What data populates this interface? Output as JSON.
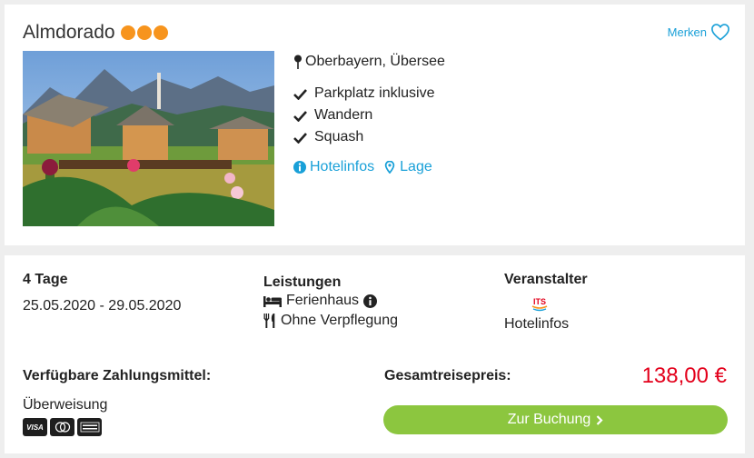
{
  "hotel": {
    "name": "Almdorado",
    "rating_dots": 3,
    "location": "Oberbayern, Übersee",
    "features": [
      "Parkplatz inklusive",
      "Wandern",
      "Squash"
    ],
    "links": {
      "info": "Hotelinfos",
      "map": "Lage"
    },
    "save_label": "Merken"
  },
  "trip": {
    "duration": "4 Tage",
    "dates": "25.05.2020 - 29.05.2020"
  },
  "services": {
    "title": "Leistungen",
    "accommodation": "Ferienhaus",
    "board": "Ohne Verpflegung"
  },
  "operator": {
    "title": "Veranstalter",
    "logo_text": "ITS",
    "link": "Hotelinfos"
  },
  "payment": {
    "title": "Verfügbare Zahlungsmittel:",
    "method": "Überweisung",
    "cards": [
      "VISA",
      "Mastercard",
      "American Express"
    ]
  },
  "pricing": {
    "label": "Gesamtreisepreis:",
    "value": "138,00 €"
  },
  "booking": {
    "button_label": "Zur Buchung"
  },
  "colors": {
    "accent_blue": "#19a0d8",
    "rating_orange": "#f7941d",
    "price_red": "#e3001b",
    "button_green": "#8cc63f"
  }
}
